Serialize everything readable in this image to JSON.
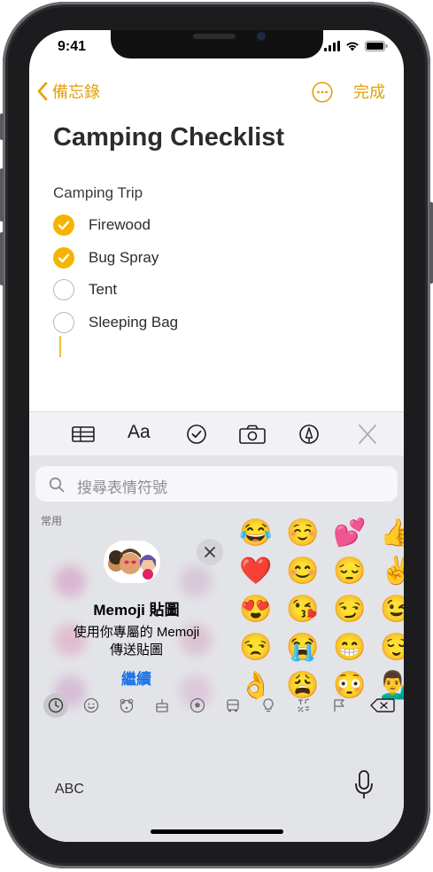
{
  "status": {
    "time": "9:41"
  },
  "nav": {
    "back_label": "備忘錄",
    "done_label": "完成"
  },
  "note": {
    "title": "Camping Checklist",
    "subheading": "Camping Trip",
    "items": [
      {
        "label": "Firewood",
        "checked": true
      },
      {
        "label": "Bug Spray",
        "checked": true
      },
      {
        "label": "Tent",
        "checked": false
      },
      {
        "label": "Sleeping Bag",
        "checked": false
      }
    ]
  },
  "toolbar": {
    "format_label": "Aa"
  },
  "emoji_keyboard": {
    "search_placeholder": "搜尋表情符號",
    "section_label": "常用",
    "memoji_card": {
      "title": "Memoji 貼圖",
      "description_line1": "使用你專屬的 Memoji",
      "description_line2": "傳送貼圖",
      "cta": "繼續"
    },
    "emojis": [
      "😂",
      "☺️",
      "💕",
      "👍",
      "❤️",
      "😊",
      "😔",
      "✌️",
      "😍",
      "😘",
      "😏",
      "😉",
      "😒",
      "😭",
      "😁",
      "😌",
      "👌",
      "😩",
      "😳",
      "💁‍♂️"
    ],
    "categories": [
      "recents",
      "smileys",
      "animals",
      "food",
      "activity",
      "travel",
      "objects",
      "symbols",
      "flags"
    ],
    "active_category": "recents",
    "abc_label": "ABC"
  },
  "colors": {
    "accent": "#e3a008",
    "check": "#f5b400",
    "link": "#1a73e8"
  }
}
